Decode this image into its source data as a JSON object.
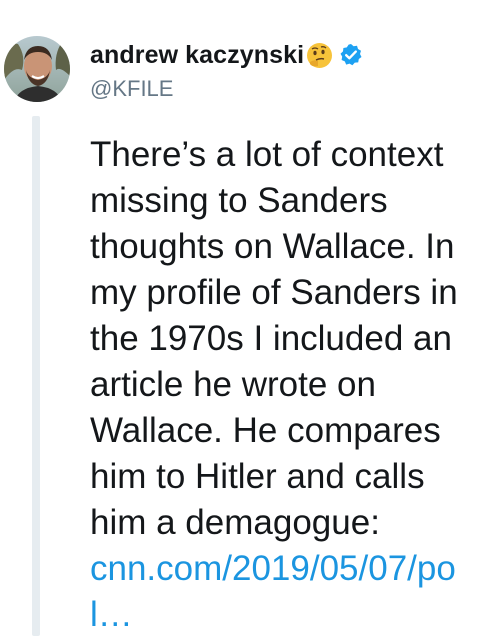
{
  "tweet": {
    "display_name": "andrew kaczynski",
    "handle": "@KFILE",
    "body": "There’s a lot of context\nmissing to Sanders\nthoughts on Wallace. In\nmy profile of Sanders in\nthe 1970s I included an\narticle he wrote on\nWallace. He compares\nhim to Hitler and calls\nhim a demagogue:\n",
    "link_text": "cnn.com/2019/05/07/po\nl…",
    "icons": {
      "emoji": "thinking-face-emoji",
      "badge": "verified-badge-icon"
    },
    "colors": {
      "link": "#1b95e0",
      "handle": "#657786",
      "verified": "#1da1f2",
      "thread_line": "#e6ecf0"
    }
  }
}
